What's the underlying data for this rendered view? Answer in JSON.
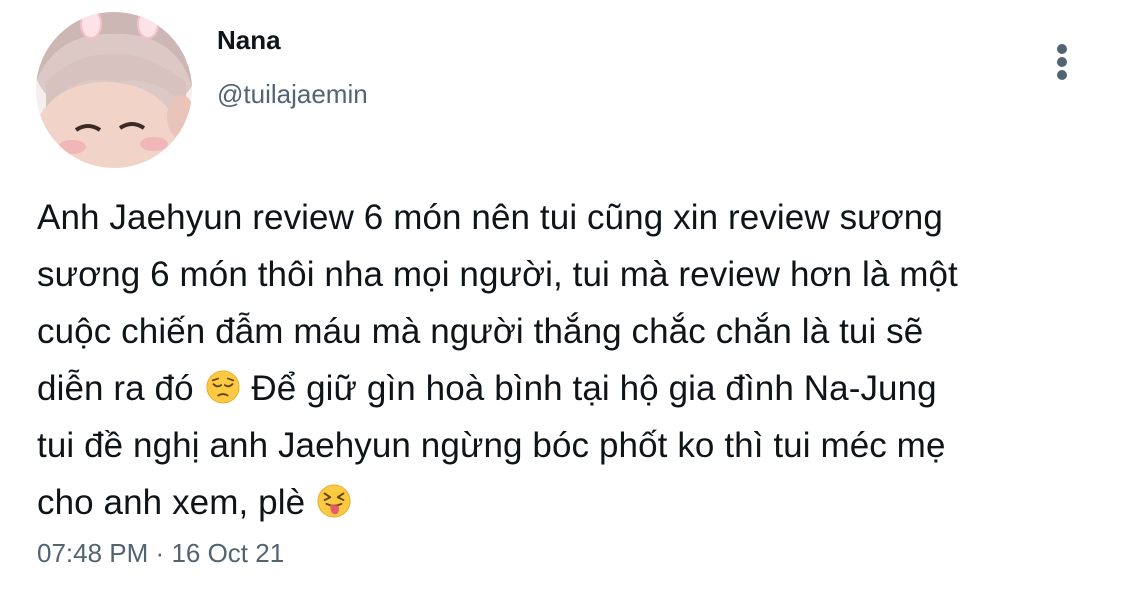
{
  "author": {
    "display_name": "Nana",
    "handle": "@tuilajaemin",
    "avatar_icon": "profile-photo"
  },
  "menu": {
    "icon": "more-vertical-icon"
  },
  "tweet": {
    "lines": [
      "Anh Jaehyun review 6 món nên tui cũng xin review sương",
      "sương 6 món thôi nha mọi người, tui mà review hơn là một",
      "cuộc chiến đẫm máu mà người thắng chắc chắn là tui sẽ",
      "diễn ra đó",
      "Để giữ gìn hoà bình tại hộ gia đình Na-Jung",
      "tui đề nghị anh Jaehyun ngừng bóc phốt ko thì tui méc mẹ",
      "cho anh xem, plè"
    ],
    "emojis": [
      "pensive-face-emoji",
      "squinting-face-with-tongue-emoji"
    ]
  },
  "meta": {
    "time": "07:48 PM",
    "separator": "·",
    "date": "16 Oct 21"
  },
  "colors": {
    "text": "#0f1419",
    "secondary": "#536471",
    "background": "#ffffff"
  }
}
